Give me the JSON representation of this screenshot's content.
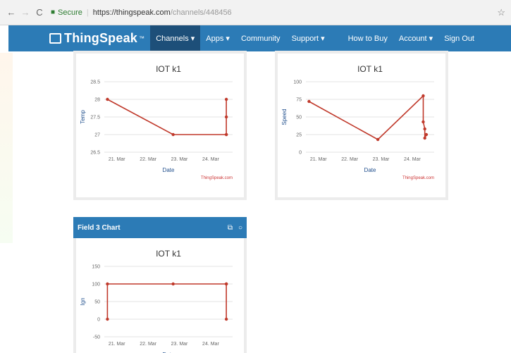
{
  "browser": {
    "back": "←",
    "forward": "→",
    "reload": "C",
    "secure_label": "Secure",
    "url_host": "https://thingspeak.com",
    "url_path": "/channels/448456",
    "bookmark": "☆"
  },
  "nav": {
    "brand": "ThingSpeak",
    "brand_tm": "™",
    "left_menu": [
      "Channels ▾",
      "Apps ▾",
      "Community",
      "Support ▾"
    ],
    "right_menu": [
      "How to Buy",
      "Account ▾",
      "Sign Out"
    ],
    "active": "Channels ▾"
  },
  "charts": [
    {
      "title": "IOT k1",
      "xlabel": "Date",
      "ylabel": "Temp",
      "credit": "ThingSpeak.com",
      "xticks": [
        "21. Mar",
        "22. Mar",
        "23. Mar",
        "24. Mar"
      ],
      "yticks": [
        "26.5",
        "27",
        "27.5",
        "28",
        "28.5"
      ]
    },
    {
      "title": "IOT k1",
      "xlabel": "Date",
      "ylabel": "Speed",
      "credit": "ThingSpeak.com",
      "xticks": [
        "21. Mar",
        "22. Mar",
        "23. Mar",
        "24. Mar"
      ],
      "yticks": [
        "0",
        "25",
        "50",
        "75",
        "100"
      ]
    },
    {
      "header": "Field 3 Chart",
      "title": "IOT k1",
      "xlabel": "Date",
      "ylabel": "Ign",
      "credit": "",
      "xticks": [
        "21. Mar",
        "22. Mar",
        "23. Mar",
        "24. Mar"
      ],
      "yticks": [
        "-50",
        "0",
        "50",
        "100",
        "150"
      ]
    }
  ],
  "chart_data": [
    {
      "type": "line",
      "title": "IOT k1",
      "xlabel": "Date",
      "ylabel": "Temp",
      "ylim": [
        26.5,
        28.5
      ],
      "xlim": [
        20.6,
        24.7
      ],
      "series": [
        {
          "x": [
            20.7,
            22.8,
            24.5,
            24.5,
            24.5,
            24.5
          ],
          "y": [
            28,
            27,
            27,
            28,
            27.5,
            27
          ]
        }
      ],
      "grid": true
    },
    {
      "type": "line",
      "title": "IOT k1",
      "xlabel": "Date",
      "ylabel": "Speed",
      "ylim": [
        0,
        100
      ],
      "xlim": [
        20.6,
        24.7
      ],
      "series": [
        {
          "x": [
            20.7,
            22.9,
            24.35,
            24.35,
            24.4,
            24.4,
            24.45
          ],
          "y": [
            72,
            18,
            80,
            43,
            33,
            20,
            25
          ]
        }
      ],
      "grid": true
    },
    {
      "type": "line",
      "title": "IOT k1",
      "xlabel": "Date",
      "ylabel": "Ign",
      "ylim": [
        -50,
        150
      ],
      "xlim": [
        20.6,
        24.7
      ],
      "series": [
        {
          "x": [
            20.7,
            20.7,
            22.8,
            24.5,
            24.5,
            24.5
          ],
          "y": [
            0,
            100,
            100,
            100,
            0,
            100
          ]
        }
      ],
      "grid": true
    }
  ],
  "field3": {
    "header": "Field 3 Chart",
    "open_icon": "external-link-icon",
    "comment_icon": "comment-icon"
  }
}
